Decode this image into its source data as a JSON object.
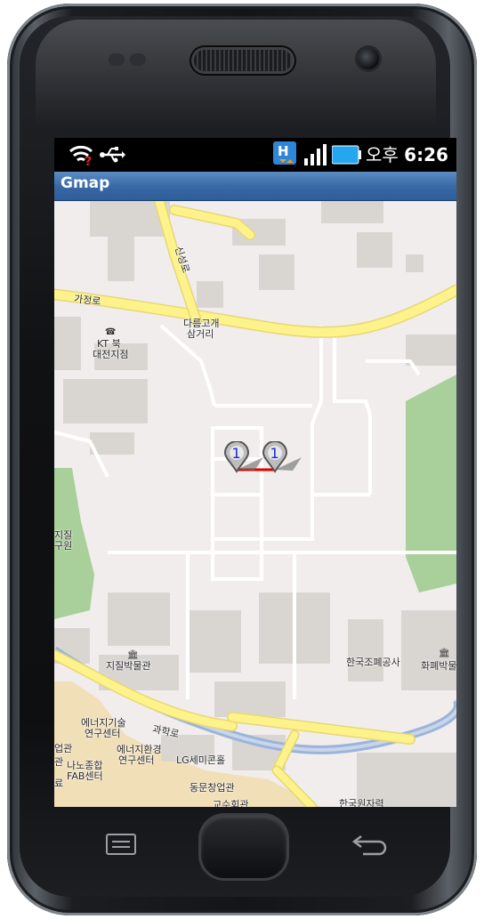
{
  "status_bar": {
    "time_prefix": "오후",
    "time": "6:26",
    "icons": [
      "wifi-warning-icon",
      "usb-icon",
      "h-network-icon",
      "signal-icon",
      "battery-icon"
    ]
  },
  "app": {
    "title": "Gmap"
  },
  "map": {
    "labels": {
      "road_gajeong": "가정로",
      "road_sinseong": "신성로",
      "junction_line1": "다름고개",
      "junction_line2": "삼거리",
      "kt_line1": "KT 북",
      "kt_line2": "대전지점",
      "geology_line1": "지질",
      "geology_line2": "구원",
      "geology_museum": "지질박물관",
      "mint": "한국조폐공사",
      "currency_museum": "화폐박물",
      "energy_tech_line1": "에너지기술",
      "energy_tech_line2": "연구센터",
      "road_gwahak": "과학로",
      "energy_env_line1": "에너지환경",
      "energy_env_line2": "연구센터",
      "lg_hall": "LG세미콘홀",
      "nano_line1": "나노종합",
      "nano_line2": "FAB센터",
      "edge_gwan": "업관",
      "edge_gwan2": "관",
      "edge_ryo": "료",
      "dongmun": "동문창업관",
      "kaist_hall": "교수회관",
      "atomic": "한국원자력"
    },
    "markers": [
      {
        "label": "1"
      },
      {
        "label": "1"
      }
    ],
    "colors": {
      "land": "#f1eded",
      "building": "#d9d6d2",
      "park": "#a9cf9a",
      "major_road": "#fdf38a",
      "minor_road": "#ffffff",
      "river": "#9db4d9",
      "campus": "#f1dfb8",
      "route_line": "#e00000"
    }
  },
  "hardware_buttons": {
    "menu": "menu-icon",
    "home": "home-button",
    "back": "back-icon"
  }
}
